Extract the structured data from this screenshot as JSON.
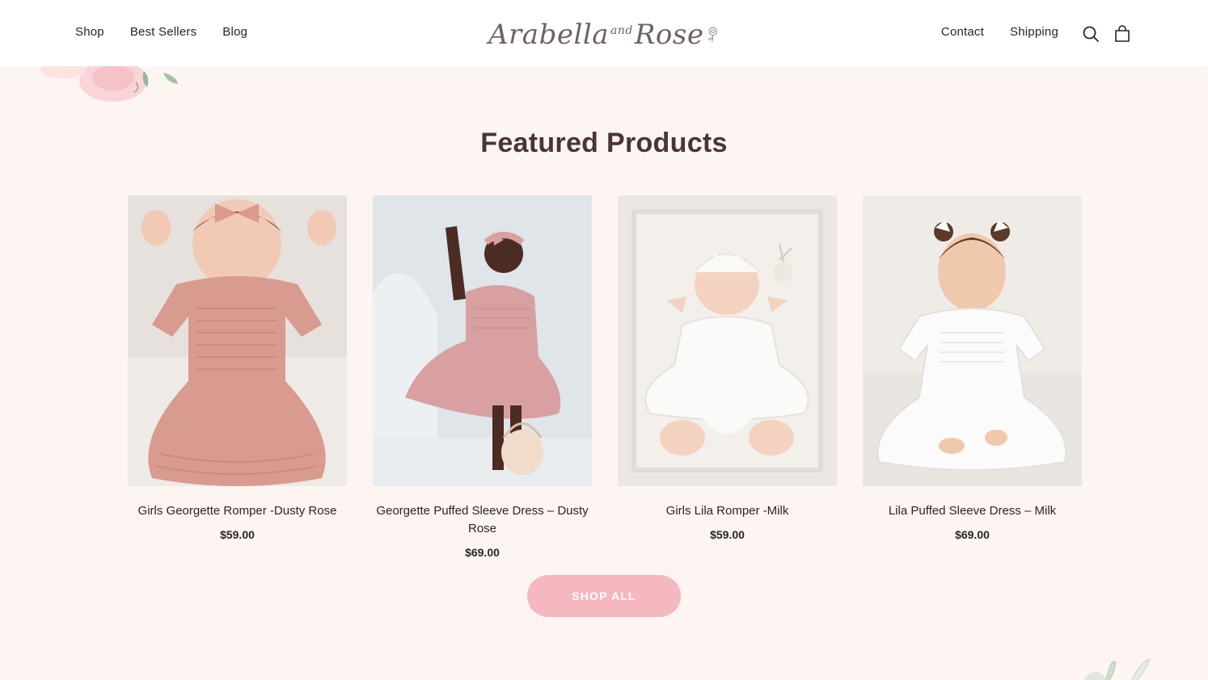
{
  "header": {
    "nav_left": [
      "Shop",
      "Best Sellers",
      "Blog"
    ],
    "nav_right": [
      "Contact",
      "Shipping"
    ],
    "logo": {
      "text_main": "Arabella",
      "text_and": "and",
      "text_end": "Rose"
    },
    "icons": [
      "search-icon",
      "cart-icon"
    ]
  },
  "featured": {
    "title": "Featured Products",
    "products": [
      {
        "name": "Girls Georgette Romper -Dusty Rose",
        "price": "$59.00",
        "image": "girl-in-dusty-rose-romper",
        "garment_color": "#d99a8f",
        "bg_color": "#eeeae6"
      },
      {
        "name": "Georgette Puffed Sleeve Dress – Dusty Rose",
        "price": "$69.00",
        "image": "girl-in-dusty-rose-dress-with-basket",
        "garment_color": "#d8a0a0",
        "bg_color": "#dfe5e8"
      },
      {
        "name": "Girls Lila Romper -Milk",
        "price": "$59.00",
        "image": "baby-in-white-romper",
        "garment_color": "#fafaf8",
        "bg_color": "#ece7e3"
      },
      {
        "name": "Lila Puffed Sleeve Dress – Milk",
        "price": "$69.00",
        "image": "girl-in-white-dress",
        "garment_color": "#fbfbfb",
        "bg_color": "#e9e6e1"
      }
    ],
    "cta": "SHOP ALL"
  },
  "colors": {
    "page_bg": "#fdf5f2",
    "header_bg": "#ffffff",
    "cta_bg": "#f5b8c0",
    "title": "#4a3434"
  }
}
